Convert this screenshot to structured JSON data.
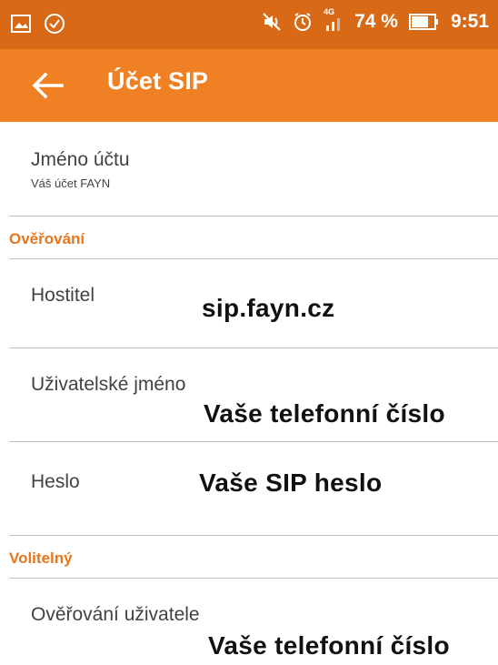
{
  "status_bar": {
    "battery_percent": "74 %",
    "time": "9:51",
    "network": "4G",
    "icons": [
      "image-icon",
      "check-circle-icon",
      "mute-icon",
      "alarm-icon",
      "signal-icon",
      "battery-icon"
    ]
  },
  "app_bar": {
    "title": "Účet SIP",
    "back_icon": "arrow-back-icon",
    "color": "#f08024"
  },
  "account": {
    "title": "Jméno účtu",
    "subtitle": "Váš účet FAYN"
  },
  "sections": {
    "auth_header": "Ověřování",
    "optional_header": "Volitelný"
  },
  "fields": {
    "host_label": "Hostitel",
    "username_label": "Uživatelské jméno",
    "password_label": "Heslo",
    "auth_user_label": "Ověřování uživatele"
  },
  "annotations": {
    "host_value": "sip.fayn.cz",
    "username_value": "Vaše telefonní číslo",
    "password_value": "Vaše SIP heslo",
    "auth_user_value": "Vaše telefonní číslo"
  },
  "colors": {
    "accent": "#f08024",
    "status_bar": "#d86a17",
    "section_header": "#e8751a"
  }
}
